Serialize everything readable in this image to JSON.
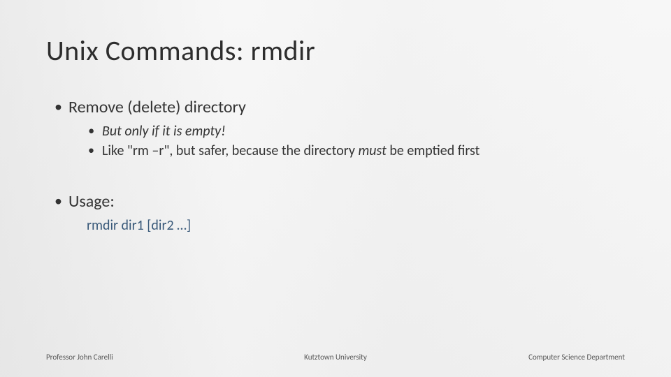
{
  "title": "Unix Commands: rmdir",
  "bullets": {
    "b1": "Remove (delete) directory",
    "b1_sub1": "But only if it is empty!",
    "b1_sub2_pre": "Like \"rm –r\", but safer, because the directory ",
    "b1_sub2_em": "must",
    "b1_sub2_post": " be emptied first",
    "b2": "Usage:",
    "usage_line": "rmdir dir1 [dir2 …]"
  },
  "footer": {
    "left": "Professor John Carelli",
    "center": "Kutztown University",
    "right": "Computer Science Department"
  }
}
